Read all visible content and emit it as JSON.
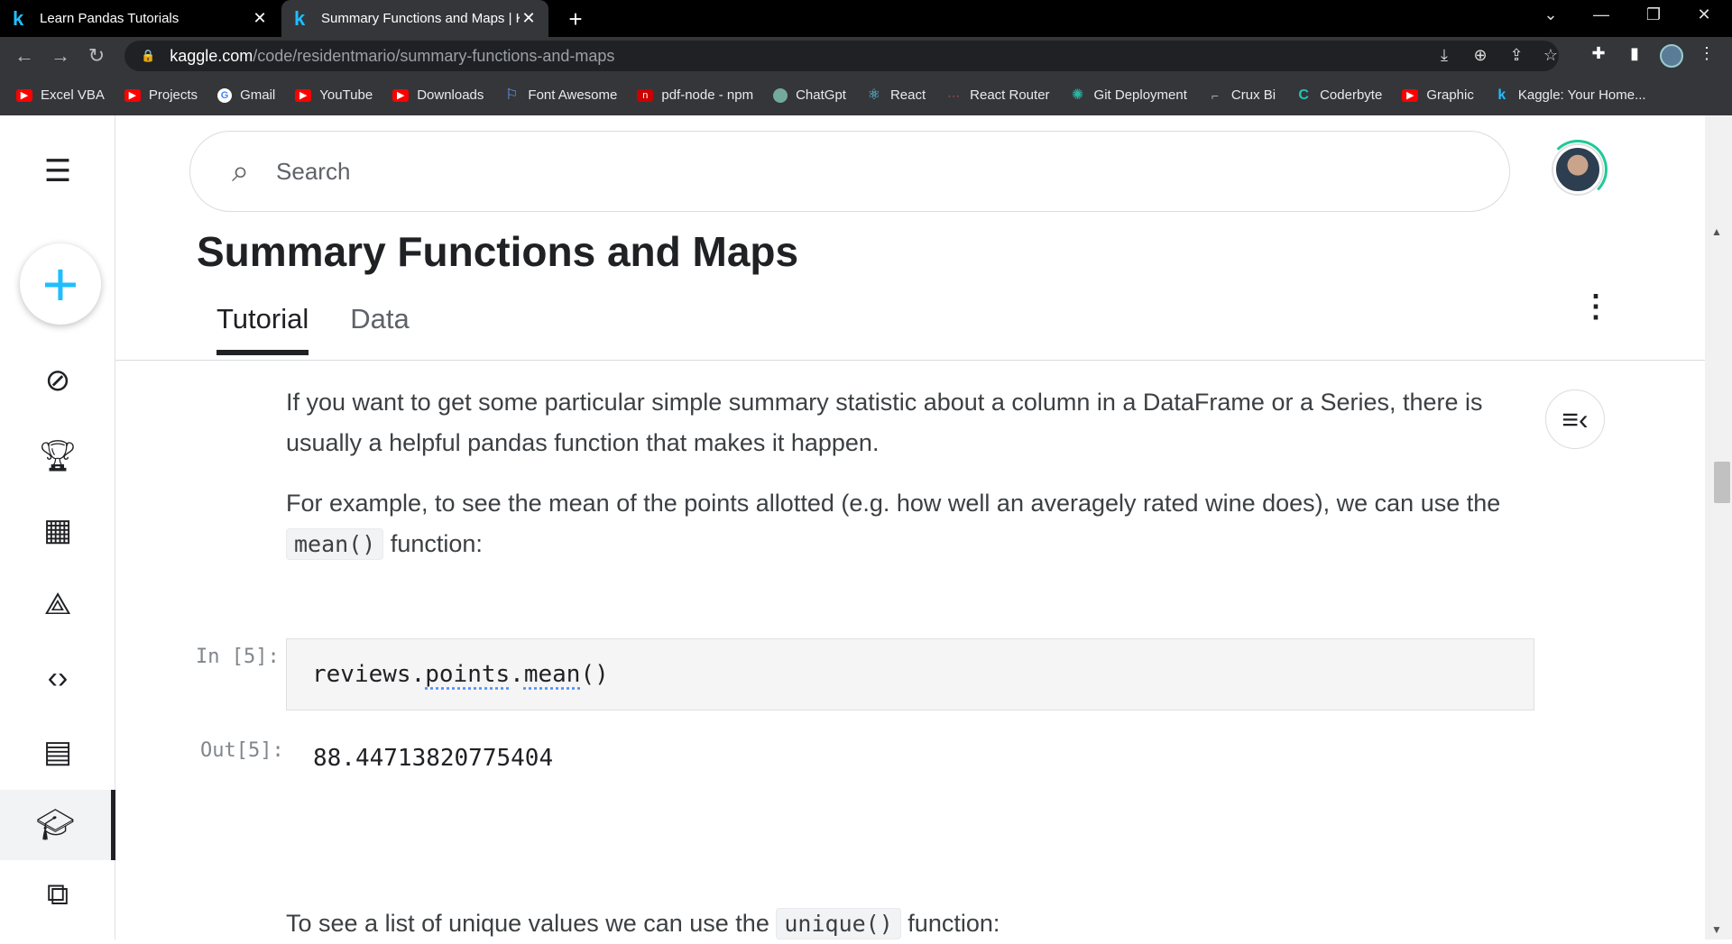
{
  "browser": {
    "tabs": [
      {
        "favicon": "k",
        "title": "Learn Pandas Tutorials",
        "close": "✕"
      },
      {
        "favicon": "k",
        "title": "Summary Functions and Maps | K",
        "close": "✕"
      }
    ],
    "new_tab": "+",
    "url_host": "kaggle.com",
    "url_path": "/code/residentmario/summary-functions-and-maps",
    "bookmarks": [
      {
        "label": "Excel VBA",
        "icon": "youtube-icon"
      },
      {
        "label": "Projects",
        "icon": "youtube-icon"
      },
      {
        "label": "Gmail",
        "icon": "google-icon"
      },
      {
        "label": "YouTube",
        "icon": "youtube-icon"
      },
      {
        "label": "Downloads",
        "icon": "youtube-icon"
      },
      {
        "label": "Font Awesome",
        "icon": "flag-icon"
      },
      {
        "label": "pdf-node - npm",
        "icon": "npm-icon"
      },
      {
        "label": "ChatGpt",
        "icon": "chatgpt-icon"
      },
      {
        "label": "React",
        "icon": "react-icon"
      },
      {
        "label": "React Router",
        "icon": "react-router-icon"
      },
      {
        "label": "Git Deployment",
        "icon": "git-icon"
      },
      {
        "label": "Crux Bi",
        "icon": "crux-icon"
      },
      {
        "label": "Coderbyte",
        "icon": "coderbyte-icon"
      },
      {
        "label": "Graphic",
        "icon": "youtube-icon"
      },
      {
        "label": "Kaggle: Your Home...",
        "icon": "kaggle-icon"
      }
    ]
  },
  "search": {
    "placeholder": "Search"
  },
  "page": {
    "title": "Summary Functions and Maps",
    "tabs": [
      "Tutorial",
      "Data"
    ],
    "para1": "If you want to get some particular simple summary statistic about a column in a DataFrame or a Series, there is usually a helpful pandas function that makes it happen.",
    "para2_prefix": "For example, to see the mean of the points allotted (e.g. how well an averagely rated wine does), we can use the",
    "para2_code": "mean()",
    "para2_suffix": "function:",
    "cell_in_prompt": "In [5]:",
    "cell_code_a": "reviews.",
    "cell_code_b": "points",
    "cell_code_c": ".",
    "cell_code_d": "mean",
    "cell_code_e": "()",
    "cell_out_prompt": "Out[5]:",
    "cell_output": "88.44713820775404",
    "para3_prefix": "To see a list of unique values we can use the",
    "para3_code": "unique()",
    "para3_suffix": "function:"
  },
  "colors": {
    "kaggle_blue": "#20beff",
    "progress_ring": "#20c997"
  }
}
